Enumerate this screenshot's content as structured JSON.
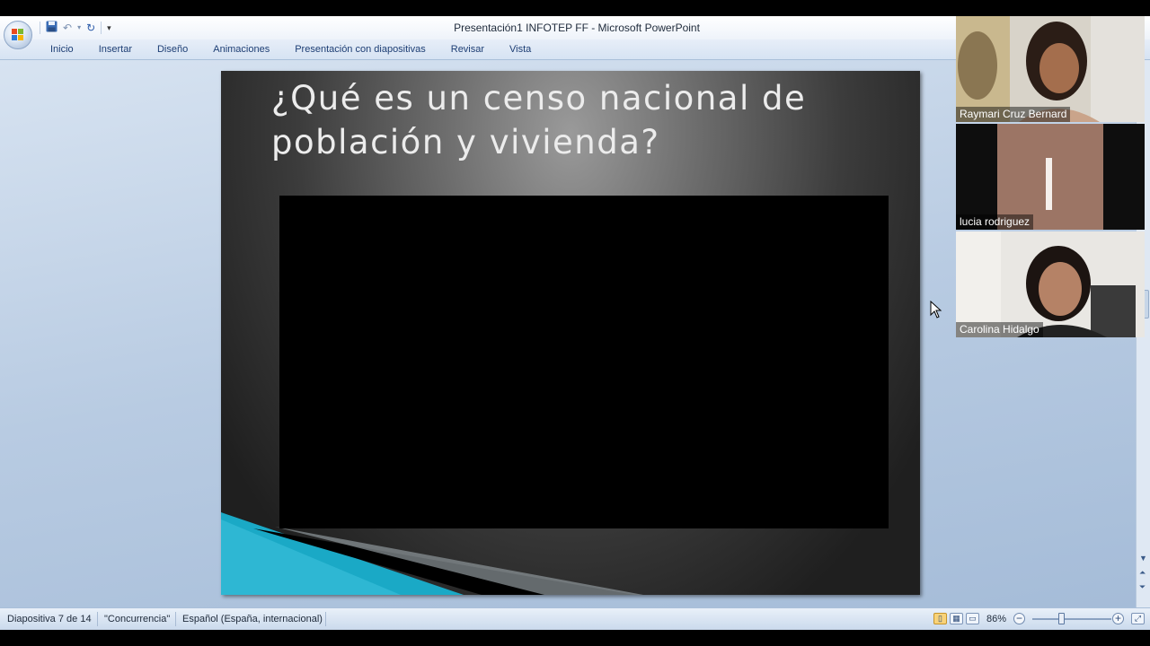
{
  "window": {
    "title": "Presentación1 INFOTEP FF - Microsoft PowerPoint"
  },
  "quick_access": {
    "icons": [
      "save-icon",
      "undo-icon",
      "redo-icon",
      "customize-icon"
    ]
  },
  "ribbon": {
    "tabs": [
      {
        "label": "Inicio"
      },
      {
        "label": "Insertar"
      },
      {
        "label": "Diseño"
      },
      {
        "label": "Animaciones"
      },
      {
        "label": "Presentación con diapositivas"
      },
      {
        "label": "Revisar"
      },
      {
        "label": "Vista"
      }
    ]
  },
  "slide": {
    "title": "¿Qué es un censo nacional de población y vivienda?"
  },
  "statusbar": {
    "slide_info": "Diapositiva 7 de 14",
    "theme": "\"Concurrencia\"",
    "language": "Español (España, internacional)",
    "zoom": "86%"
  },
  "participants": [
    {
      "name": "Raymari Cruz Bernard"
    },
    {
      "name": "lucia rodriguez"
    },
    {
      "name": "Carolina Hidalgo"
    }
  ],
  "colors": {
    "accent_teal": "#1aa9c6",
    "ribbon_bg": "#d6e3f3",
    "workspace_bg": "#b8cbe2",
    "slide_title": "#ececec"
  }
}
